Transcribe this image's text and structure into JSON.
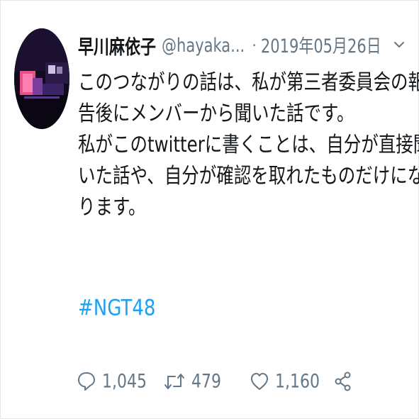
{
  "tweet": {
    "display_name": "早川麻依子",
    "handle": "@hayaka...",
    "separator": "·",
    "date": "2019年05月26日",
    "body_lines": [
      "このつながりの話は、私が第三者委員会の報",
      "告後にメンバーから聞いた話です。",
      "私がこのtwitterに書くことは、自分が直接聞",
      "いた話や、自分が確認を取れたものだけにな",
      "ります。"
    ],
    "hashtag": "#NGT48"
  },
  "actions": {
    "reply_count": "1,045",
    "retweet_count": "479",
    "like_count": "1,160"
  },
  "icons": {
    "more": "chevron-down-icon",
    "reply": "reply-icon",
    "retweet": "retweet-icon",
    "like": "heart-icon",
    "share": "share-icon"
  },
  "colors": {
    "text": "#14171a",
    "secondary": "#657786",
    "link": "#1da1f2",
    "border": "#e1e8ed"
  }
}
